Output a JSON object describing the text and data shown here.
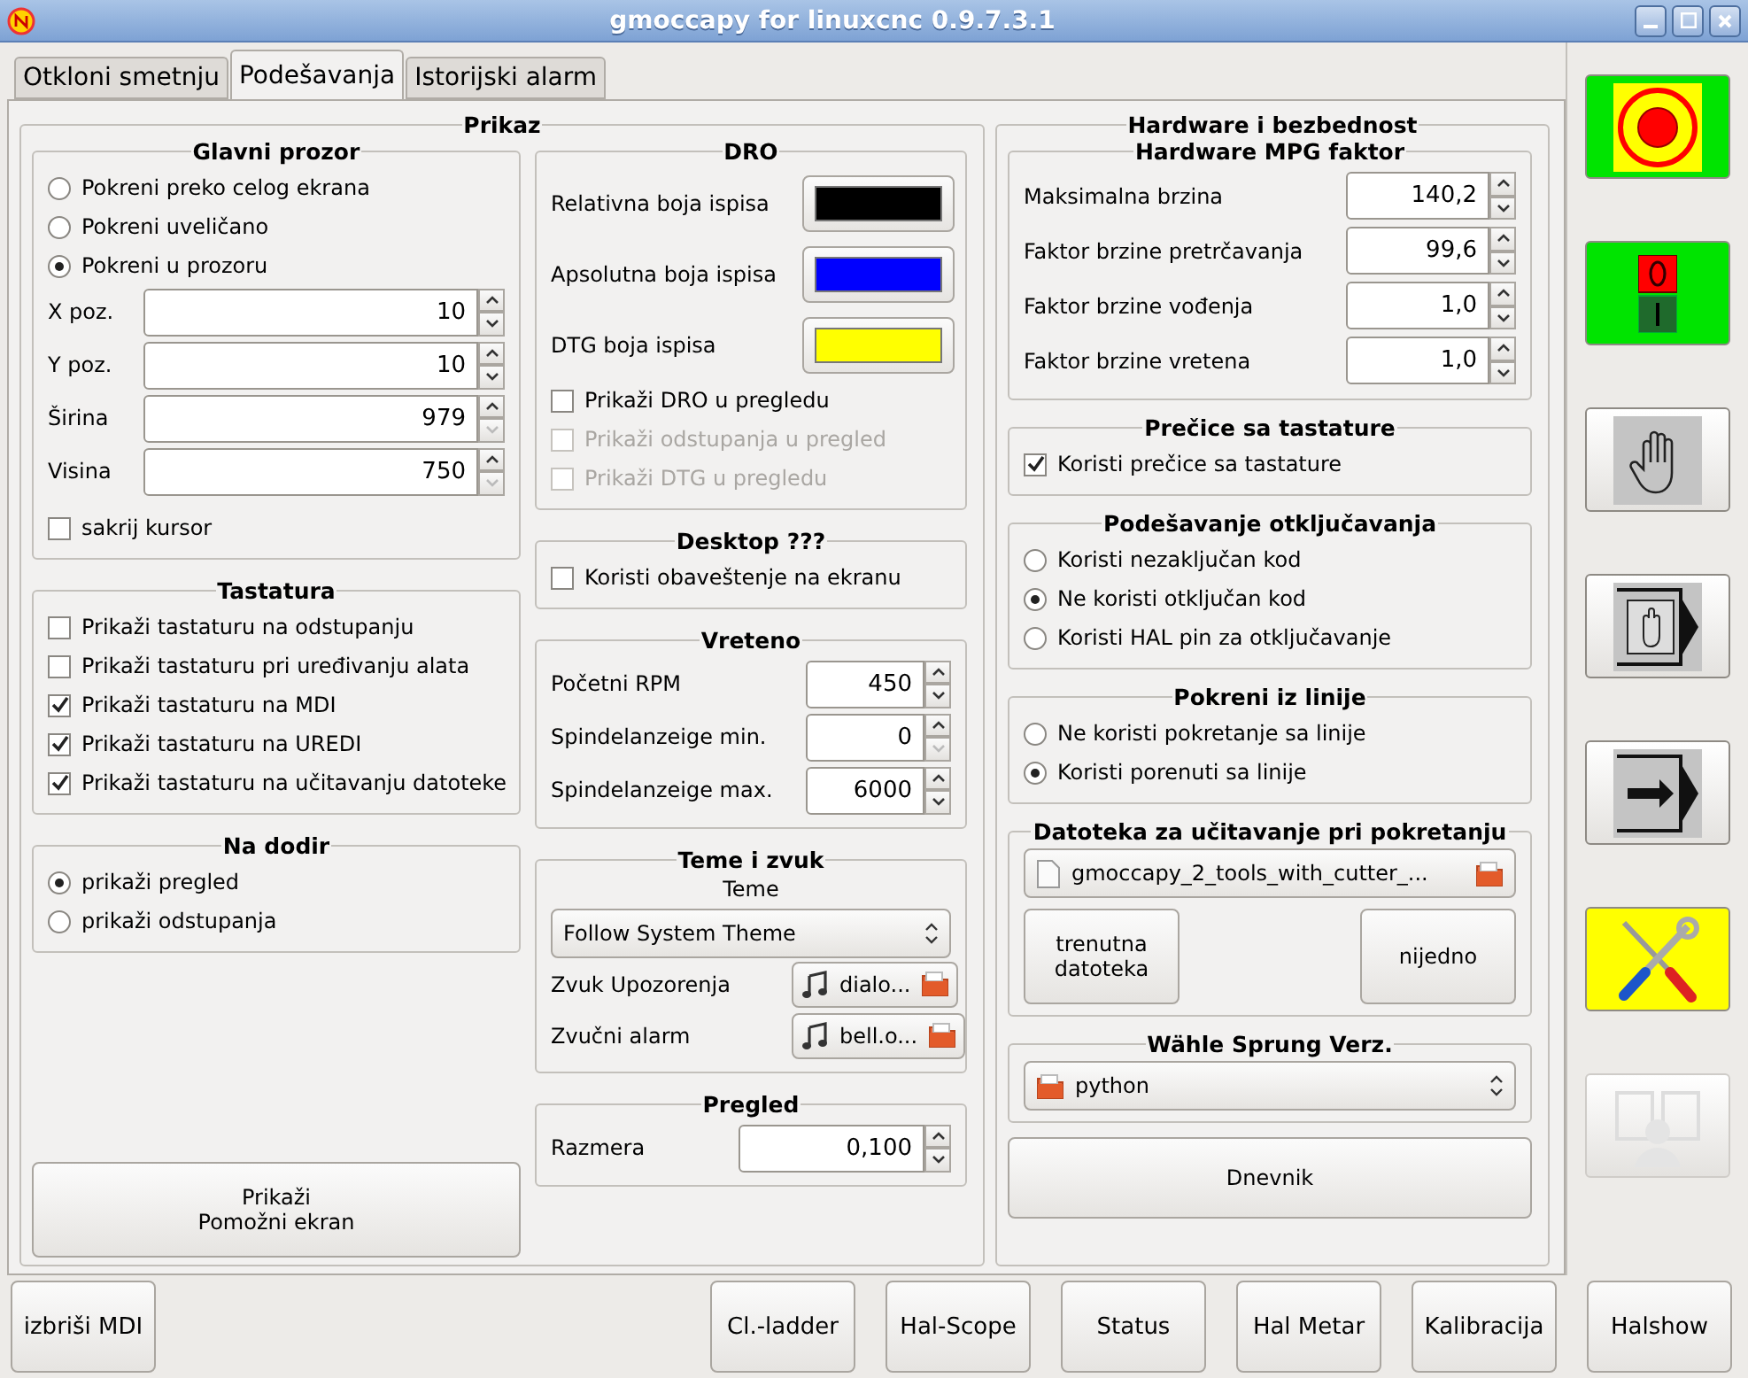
{
  "window": {
    "title": "gmoccapy for linuxcnc 0.9.7.3.1"
  },
  "tabs": [
    {
      "label": "Otkloni smetnju",
      "selected": false
    },
    {
      "label": "Podešavanja",
      "selected": true
    },
    {
      "label": "Istorijski alarm",
      "selected": false
    }
  ],
  "prikaz": {
    "title": "Prikaz",
    "glavni_prozor": {
      "title": "Glavni prozor",
      "options": [
        {
          "label": "Pokreni preko celog ekrana",
          "selected": false
        },
        {
          "label": "Pokreni uveličano",
          "selected": false
        },
        {
          "label": "Pokreni u prozoru",
          "selected": true
        }
      ],
      "fields": [
        {
          "label": "X poz.",
          "value": "10",
          "down_disabled": false
        },
        {
          "label": "Y poz.",
          "value": "10",
          "down_disabled": false
        },
        {
          "label": "Širina",
          "value": "979",
          "down_disabled": true
        },
        {
          "label": "Visina",
          "value": "750",
          "down_disabled": true
        }
      ],
      "hide_cursor": {
        "label": "sakrij kursor",
        "checked": false
      }
    },
    "tastatura": {
      "title": "Tastatura",
      "items": [
        {
          "label": "Prikaži tastaturu na odstupanju",
          "checked": false
        },
        {
          "label": "Prikaži tastaturu pri uređivanju alata",
          "checked": false
        },
        {
          "label": "Prikaži tastaturu na MDI",
          "checked": true
        },
        {
          "label": "Prikaži tastaturu na UREDI",
          "checked": true
        },
        {
          "label": "Prikaži tastaturu na učitavanju datoteke",
          "checked": true
        }
      ]
    },
    "na_dodir": {
      "title": "Na dodir",
      "options": [
        {
          "label": "prikaži pregled",
          "selected": true
        },
        {
          "label": "prikaži odstupanja",
          "selected": false
        }
      ]
    },
    "secondary_button": {
      "lines": [
        "Prikaži",
        "Pomožni ekran"
      ]
    },
    "dro": {
      "title": "DRO",
      "colors": [
        {
          "label": "Relativna boja ispisa",
          "color": "#000000"
        },
        {
          "label": "Apsolutna boja ispisa",
          "color": "#0000ff"
        },
        {
          "label": "DTG boja ispisa",
          "color": "#ffff00"
        }
      ],
      "checks": [
        {
          "label": "Prikaži DRO u pregledu",
          "checked": false,
          "disabled": false
        },
        {
          "label": "Prikaži odstupanja u pregled",
          "checked": false,
          "disabled": true
        },
        {
          "label": "Prikaži DTG u pregledu",
          "checked": false,
          "disabled": true
        }
      ]
    },
    "desktop": {
      "title": "Desktop ???",
      "check": {
        "label": "Koristi obaveštenje na ekranu",
        "checked": false
      }
    },
    "vreteno": {
      "title": "Vreteno",
      "fields": [
        {
          "label": "Početni RPM",
          "value": "450",
          "down_disabled": false
        },
        {
          "label": "Spindelanzeige min.",
          "value": "0",
          "down_disabled": true
        },
        {
          "label": "Spindelanzeige max.",
          "value": "6000",
          "down_disabled": false
        }
      ]
    },
    "teme": {
      "title": "Teme i zvuk",
      "theme_label": "Teme",
      "theme_value": "Follow System Theme",
      "sounds": [
        {
          "label": "Zvuk Upozorenja",
          "file": "dialo..."
        },
        {
          "label": "Zvučni alarm",
          "file": "bell.o..."
        }
      ]
    },
    "pregled": {
      "title": "Pregled",
      "field": {
        "label": "Razmera",
        "value": "0,100",
        "down_disabled": false
      }
    }
  },
  "hardware": {
    "title": "Hardware i bezbednost",
    "mpg": {
      "title": "Hardware MPG faktor",
      "fields": [
        {
          "label": "Maksimalna brzina",
          "value": "140,2",
          "down_disabled": false
        },
        {
          "label": "Faktor brzine pretrčavanja",
          "value": "99,6",
          "down_disabled": false
        },
        {
          "label": "Faktor brzine vođenja",
          "value": "1,0",
          "down_disabled": false
        },
        {
          "label": "Faktor brzine vretena",
          "value": "1,0",
          "down_disabled": false
        }
      ]
    },
    "precice": {
      "title": "Prečice sa tastature",
      "check": {
        "label": "Koristi prečice sa tastature",
        "checked": true
      }
    },
    "otkljucavanje": {
      "title": "Podešavanje otključavanja",
      "options": [
        {
          "label": "Koristi nezaključan kod",
          "selected": false
        },
        {
          "label": "Ne koristi otključan kod",
          "selected": true
        },
        {
          "label": "Koristi HAL pin za otključavanje",
          "selected": false
        }
      ]
    },
    "pokreni": {
      "title": "Pokreni iz linije",
      "options": [
        {
          "label": "Ne koristi pokretanje sa linije",
          "selected": false
        },
        {
          "label": "Koristi porenuti sa linije",
          "selected": true
        }
      ]
    },
    "datoteka": {
      "title": "Datoteka za učitavanje pri pokretanju",
      "file": "gmoccapy_2_tools_with_cutter_...",
      "buttons": [
        {
          "lines": [
            "trenutna",
            "datoteka"
          ]
        },
        {
          "lines": [
            "nijedno"
          ]
        }
      ]
    },
    "sprung": {
      "title": "Wähle Sprung Verz.",
      "value": "python"
    },
    "log_button": "Dnevnik"
  },
  "side_buttons": [
    {
      "kind": "estop",
      "color": "#00e400",
      "disabled": false
    },
    {
      "kind": "power",
      "color": "#00e400",
      "disabled": false
    },
    {
      "kind": "manual",
      "disabled": false
    },
    {
      "kind": "mdi",
      "disabled": false
    },
    {
      "kind": "auto",
      "disabled": false
    },
    {
      "kind": "settings",
      "color": "#ffff00",
      "disabled": false
    },
    {
      "kind": "user",
      "disabled": true
    }
  ],
  "bottom_buttons": [
    "izbriši MDI",
    "Cl.-ladder",
    "Hal-Scope",
    "Status",
    "Hal Metar",
    "Kalibracija",
    "Halshow"
  ]
}
